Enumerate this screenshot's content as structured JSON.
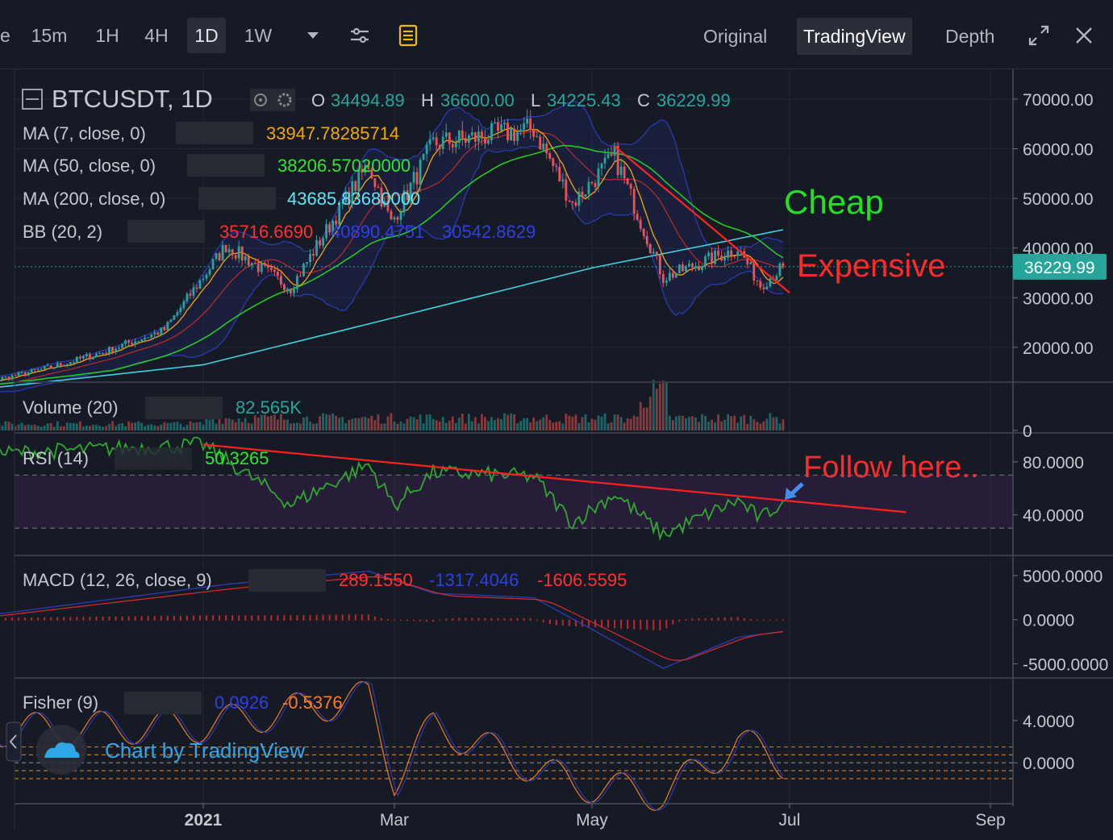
{
  "toolbar": {
    "timeframes": [
      {
        "label": "e",
        "active": false
      },
      {
        "label": "15m",
        "active": false
      },
      {
        "label": "1H",
        "active": false
      },
      {
        "label": "4H",
        "active": false
      },
      {
        "label": "1D",
        "active": true
      },
      {
        "label": "1W",
        "active": false
      }
    ],
    "dropdown_icon": "chevron-down-icon",
    "settings_icon": "sliders-icon",
    "indicators_icon": "note-icon",
    "views": [
      {
        "label": "Original",
        "active": false
      },
      {
        "label": "TradingView",
        "active": true
      },
      {
        "label": "Depth",
        "active": false
      }
    ],
    "expand_icon": "expand-icon",
    "close_icon": "close-icon"
  },
  "colors": {
    "background": "#161a25",
    "up": "#26a69a",
    "down": "#ef5350",
    "ma7": "#f7a600",
    "ma50": "#26c826",
    "ma200": "#40d0e6",
    "bb_mid": "#e03030",
    "bb_band": "#2a3ab0",
    "rsi": "#2ea82e",
    "annotation_red": "#ff2a2a",
    "annotation_green": "#22e022"
  },
  "legend": {
    "symbol": "BTCUSDT, 1D",
    "ohlc": [
      {
        "k": "O",
        "v": "34494.89"
      },
      {
        "k": "H",
        "v": "36600.00"
      },
      {
        "k": "L",
        "v": "34225.43"
      },
      {
        "k": "C",
        "v": "36229.99"
      }
    ],
    "ma7": {
      "name": "MA (7, close, 0)",
      "value": "33947.78285714"
    },
    "ma50": {
      "name": "MA (50, close, 0)",
      "value": "38206.57020000"
    },
    "ma200": {
      "name": "MA (200, close, 0)",
      "value": "43685.83680000"
    },
    "bb": {
      "name": "BB (20, 2)",
      "values": [
        "35716.6690",
        "40890.4751",
        "30542.8629"
      ]
    },
    "volume": {
      "name": "Volume (20)",
      "value": "82.565K"
    },
    "rsi": {
      "name": "RSI (14)",
      "value": "50.3265"
    },
    "macd": {
      "name": "MACD (12, 26, close, 9)",
      "values": [
        "289.1550",
        "-1317.4046",
        "-1606.5595"
      ]
    },
    "fisher": {
      "name": "Fisher (9)",
      "values": [
        "0.0926",
        "-0.5376"
      ]
    }
  },
  "annotations": {
    "cheap": "Cheap",
    "expensive": "Expensive",
    "follow": "Follow here.."
  },
  "watermark": "Chart by TradingView",
  "price_tag": "36229.99",
  "chart_data": [
    {
      "type": "candlestick",
      "title": "BTCUSDT, 1D",
      "x_ticks": [
        "2021",
        "Mar",
        "May",
        "Jul",
        "Sep"
      ],
      "x_ticks_dates": [
        "2021-01-01",
        "2021-03-01",
        "2021-05-01",
        "2021-07-01",
        "2021-09-01"
      ],
      "ylim": [
        13000,
        76000
      ],
      "y_ticks": [
        "70000.00",
        "60000.00",
        "50000.00",
        "40000.00",
        "30000.00",
        "20000.00"
      ],
      "y_ticks_values": [
        70000,
        60000,
        50000,
        40000,
        30000,
        20000
      ],
      "monthly_close": [
        {
          "date": "2020-10-16",
          "close": 11500
        },
        {
          "date": "2020-11-15",
          "close": 16000
        },
        {
          "date": "2020-12-01",
          "close": 19000
        },
        {
          "date": "2020-12-20",
          "close": 23500
        },
        {
          "date": "2021-01-08",
          "close": 40500
        },
        {
          "date": "2021-01-28",
          "close": 32000
        },
        {
          "date": "2021-02-21",
          "close": 57000
        },
        {
          "date": "2021-02-28",
          "close": 45000
        },
        {
          "date": "2021-03-13",
          "close": 61000
        },
        {
          "date": "2021-04-13",
          "close": 64000
        },
        {
          "date": "2021-04-25",
          "close": 49000
        },
        {
          "date": "2021-05-08",
          "close": 58500
        },
        {
          "date": "2021-05-23",
          "close": 34000
        },
        {
          "date": "2021-06-15",
          "close": 40000
        },
        {
          "date": "2021-06-22",
          "close": 32500
        },
        {
          "date": "2021-06-29",
          "close": 36229.99
        }
      ],
      "ma200_path": [
        {
          "date": "2020-10-16",
          "value": 11000
        },
        {
          "date": "2021-01-01",
          "value": 16500
        },
        {
          "date": "2021-03-01",
          "value": 26000
        },
        {
          "date": "2021-05-01",
          "value": 36000
        },
        {
          "date": "2021-06-29",
          "value": 43685.84
        }
      ],
      "trendline": [
        {
          "date": "2021-05-08",
          "value": 60500
        },
        {
          "date": "2021-07-01",
          "value": 31000
        }
      ],
      "last_price": 36229.99
    },
    {
      "type": "bar",
      "title": "Volume (20)",
      "ylim": [
        0,
        160000
      ],
      "y_ticks": [
        "0"
      ],
      "y_ticks_values": [
        0
      ],
      "last_value": 82565
    },
    {
      "type": "line",
      "title": "RSI (14)",
      "ylim": [
        10,
        100
      ],
      "y_ticks": [
        "80.0000",
        "40.0000"
      ],
      "y_ticks_values": [
        80,
        40
      ],
      "band": [
        30,
        70
      ],
      "series": [
        {
          "values_sample": [
            {
              "date": "2020-10-16",
              "value": 85
            },
            {
              "date": "2021-01-01",
              "value": 93
            },
            {
              "date": "2021-01-28",
              "value": 48
            },
            {
              "date": "2021-02-21",
              "value": 78
            },
            {
              "date": "2021-03-01",
              "value": 47
            },
            {
              "date": "2021-03-13",
              "value": 72
            },
            {
              "date": "2021-04-13",
              "value": 69
            },
            {
              "date": "2021-04-25",
              "value": 34
            },
            {
              "date": "2021-05-08",
              "value": 56
            },
            {
              "date": "2021-05-23",
              "value": 25
            },
            {
              "date": "2021-06-15",
              "value": 51
            },
            {
              "date": "2021-06-22",
              "value": 37
            },
            {
              "date": "2021-06-29",
              "value": 50.33
            }
          ]
        }
      ],
      "trendline": [
        {
          "date": "2021-01-01",
          "value": 93
        },
        {
          "date": "2021-08-06",
          "value": 42
        }
      ]
    },
    {
      "type": "line",
      "title": "MACD (12, 26, close, 9)",
      "ylim": [
        -6500,
        7000
      ],
      "y_ticks": [
        "5000.0000",
        "0.0000",
        "-5000.0000"
      ],
      "y_ticks_values": [
        5000,
        0,
        -5000
      ],
      "series": [
        {
          "values_sample": [
            {
              "date": "2020-10-16",
              "value": 0
            },
            {
              "date": "2021-01-08",
              "value": 4000
            },
            {
              "date": "2021-02-21",
              "value": 5500
            },
            {
              "date": "2021-03-13",
              "value": 3000
            },
            {
              "date": "2021-04-13",
              "value": 2500
            },
            {
              "date": "2021-05-23",
              "value": -5500
            },
            {
              "date": "2021-06-15",
              "value": -2000
            },
            {
              "date": "2021-06-29",
              "value": -1317.4
            }
          ]
        }
      ]
    },
    {
      "type": "line",
      "title": "Fisher (9)",
      "ylim": [
        -3.8,
        7.8
      ],
      "y_ticks": [
        "4.0000",
        "0.0000"
      ],
      "y_ticks_values": [
        4,
        0
      ],
      "levels": [
        1.5,
        0.75,
        0,
        -0.75,
        -1.5
      ],
      "series": [
        {
          "values_sample": [
            {
              "date": "2020-10-16",
              "value": 3
            },
            {
              "date": "2021-01-01",
              "value": 3.5
            },
            {
              "date": "2021-02-21",
              "value": 6.2
            },
            {
              "date": "2021-03-01",
              "value": -1.5
            },
            {
              "date": "2021-03-13",
              "value": 3.5
            },
            {
              "date": "2021-04-25",
              "value": -2
            },
            {
              "date": "2021-05-23",
              "value": -3
            },
            {
              "date": "2021-06-15",
              "value": 2
            },
            {
              "date": "2021-06-29",
              "value": 0.09
            }
          ]
        }
      ]
    }
  ]
}
